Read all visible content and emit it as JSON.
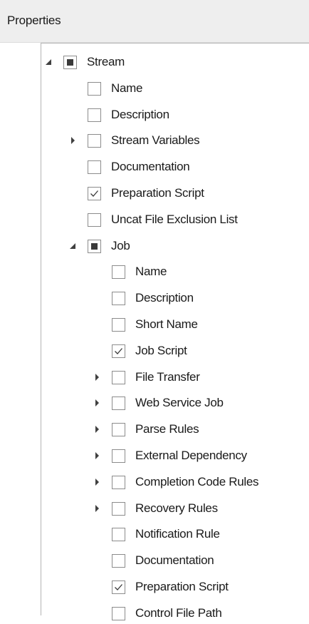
{
  "panel": {
    "title": "Properties"
  },
  "tree": [
    {
      "label": "Stream",
      "level": 0,
      "expander": "expanded",
      "state": "indeterminate",
      "name": "stream"
    },
    {
      "label": "Name",
      "level": 1,
      "expander": "none",
      "state": "unchecked",
      "name": "stream-name"
    },
    {
      "label": "Description",
      "level": 1,
      "expander": "none",
      "state": "unchecked",
      "name": "stream-description"
    },
    {
      "label": "Stream Variables",
      "level": 1,
      "expander": "collapsed",
      "state": "unchecked",
      "name": "stream-variables"
    },
    {
      "label": "Documentation",
      "level": 1,
      "expander": "none",
      "state": "unchecked",
      "name": "stream-documentation"
    },
    {
      "label": "Preparation Script",
      "level": 1,
      "expander": "none",
      "state": "checked",
      "name": "stream-preparation-script"
    },
    {
      "label": "Uncat File Exclusion List",
      "level": 1,
      "expander": "none",
      "state": "unchecked",
      "name": "stream-uncat-file-exclusion-list"
    },
    {
      "label": "Job",
      "level": 1,
      "expander": "expanded",
      "state": "indeterminate",
      "name": "job"
    },
    {
      "label": "Name",
      "level": 2,
      "expander": "none",
      "state": "unchecked",
      "name": "job-name"
    },
    {
      "label": "Description",
      "level": 2,
      "expander": "none",
      "state": "unchecked",
      "name": "job-description"
    },
    {
      "label": "Short Name",
      "level": 2,
      "expander": "none",
      "state": "unchecked",
      "name": "job-short-name"
    },
    {
      "label": "Job Script",
      "level": 2,
      "expander": "none",
      "state": "checked",
      "name": "job-script"
    },
    {
      "label": "File Transfer",
      "level": 2,
      "expander": "collapsed",
      "state": "unchecked",
      "name": "job-file-transfer"
    },
    {
      "label": "Web Service Job",
      "level": 2,
      "expander": "collapsed",
      "state": "unchecked",
      "name": "job-web-service-job"
    },
    {
      "label": "Parse Rules",
      "level": 2,
      "expander": "collapsed",
      "state": "unchecked",
      "name": "job-parse-rules"
    },
    {
      "label": "External Dependency",
      "level": 2,
      "expander": "collapsed",
      "state": "unchecked",
      "name": "job-external-dependency"
    },
    {
      "label": "Completion Code Rules",
      "level": 2,
      "expander": "collapsed",
      "state": "unchecked",
      "name": "job-completion-code-rules"
    },
    {
      "label": "Recovery Rules",
      "level": 2,
      "expander": "collapsed",
      "state": "unchecked",
      "name": "job-recovery-rules"
    },
    {
      "label": "Notification Rule",
      "level": 2,
      "expander": "none",
      "state": "unchecked",
      "name": "job-notification-rule"
    },
    {
      "label": "Documentation",
      "level": 2,
      "expander": "none",
      "state": "unchecked",
      "name": "job-documentation"
    },
    {
      "label": "Preparation Script",
      "level": 2,
      "expander": "none",
      "state": "checked",
      "name": "job-preparation-script"
    },
    {
      "label": "Control File Path",
      "level": 2,
      "expander": "none",
      "state": "unchecked",
      "name": "job-control-file-path"
    }
  ]
}
